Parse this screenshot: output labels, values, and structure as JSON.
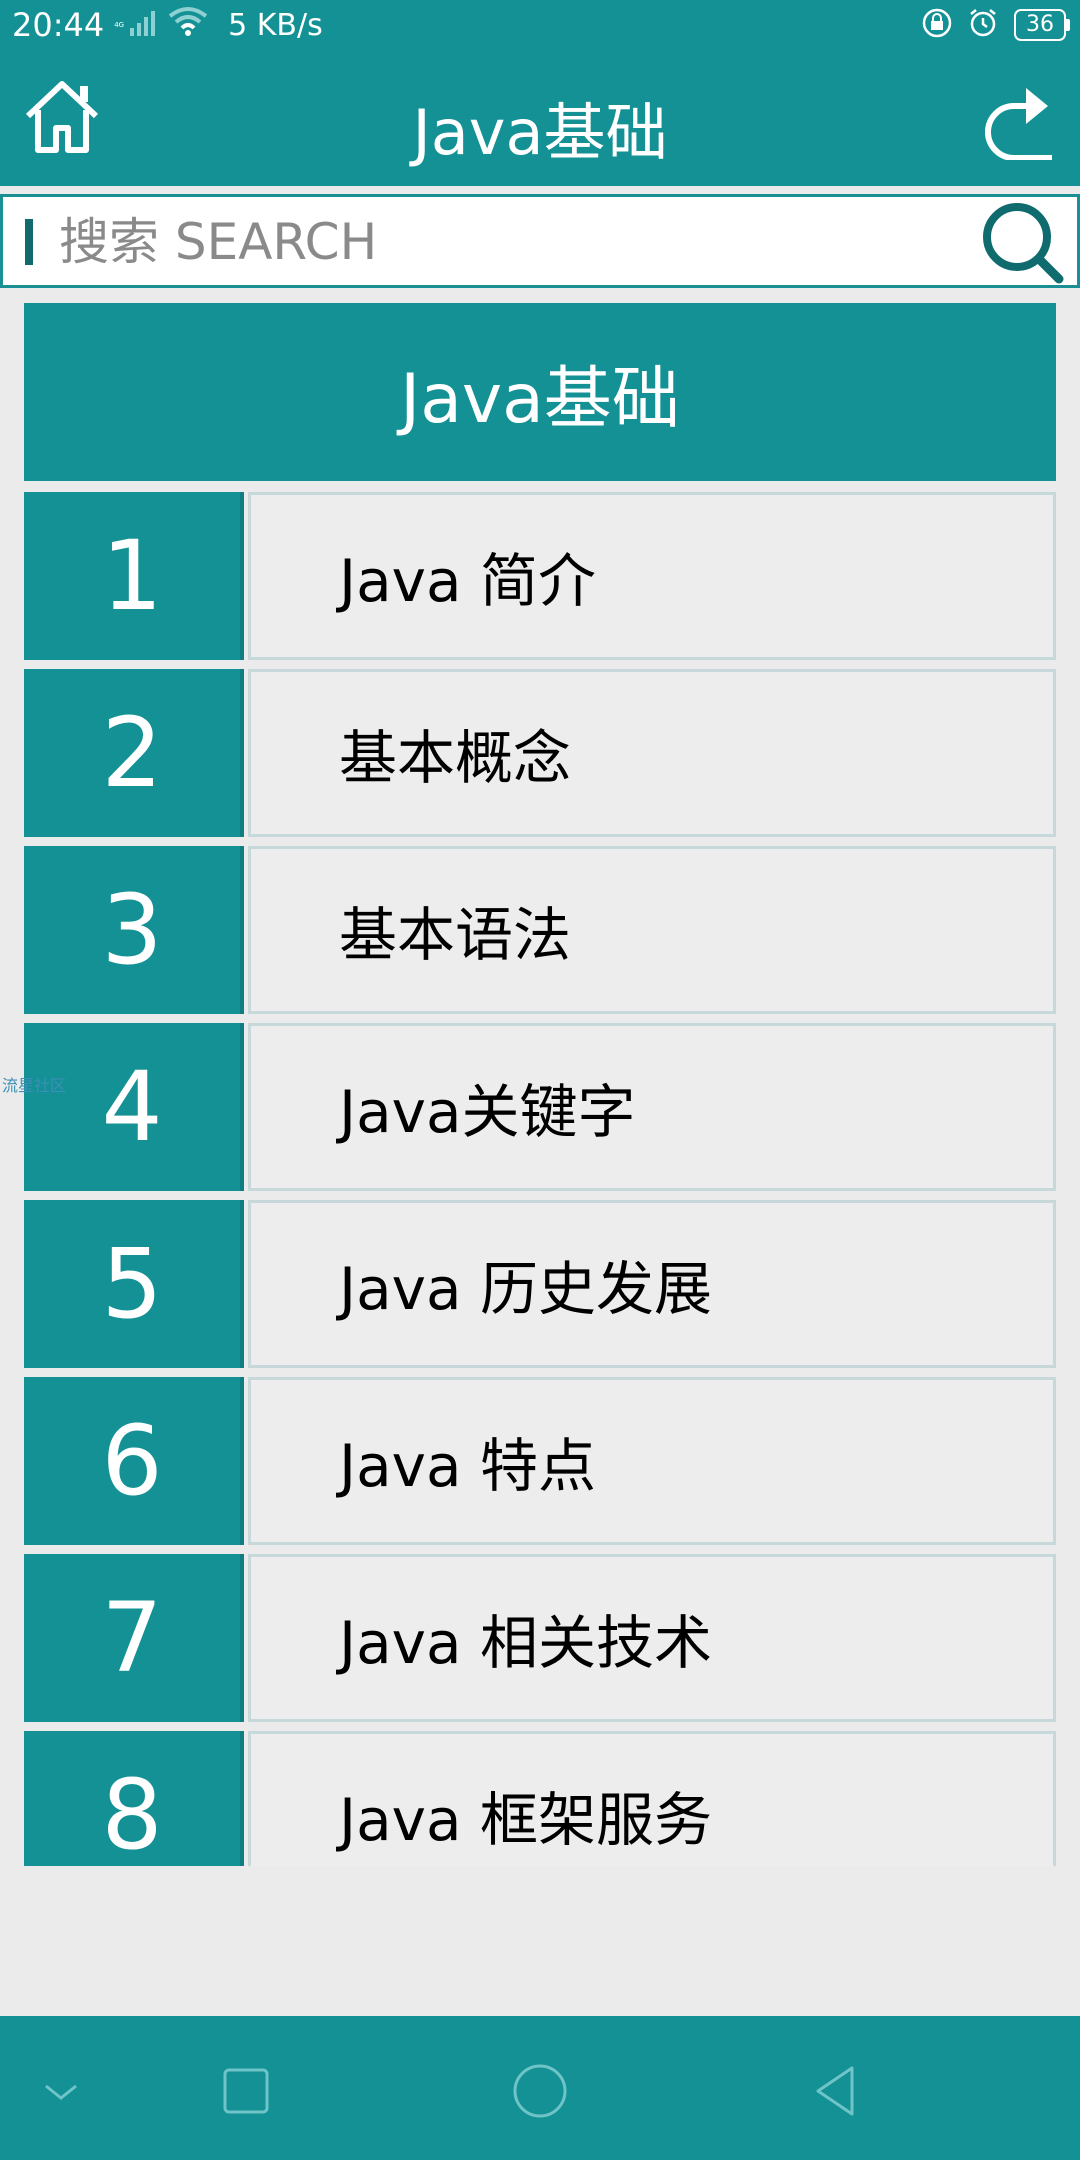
{
  "status_bar": {
    "time": "20:44",
    "network": "4G",
    "speed": "5 KB/s",
    "battery": "36",
    "icons": [
      "signal-icon",
      "wifi-icon",
      "lock-icon",
      "alarm-icon",
      "battery-icon"
    ]
  },
  "app_bar": {
    "title": "Java基础",
    "home_icon": "home-icon",
    "refresh_icon": "refresh-icon"
  },
  "search": {
    "placeholder": "搜索 SEARCH",
    "icon": "search-icon"
  },
  "section": {
    "title": "Java基础"
  },
  "list": [
    {
      "num": "1",
      "label": "Java 简介"
    },
    {
      "num": "2",
      "label": "基本概念"
    },
    {
      "num": "3",
      "label": "基本语法"
    },
    {
      "num": "4",
      "label": "Java关键字"
    },
    {
      "num": "5",
      "label": "Java 历史发展"
    },
    {
      "num": "6",
      "label": "Java 特点"
    },
    {
      "num": "7",
      "label": "Java 相关技术"
    },
    {
      "num": "8",
      "label": "Java 框架服务"
    }
  ],
  "watermark": "流星社区",
  "nav_bar": {
    "icons": [
      "chevron-down-icon",
      "recents-icon",
      "home-circle-icon",
      "back-icon"
    ]
  },
  "colors": {
    "primary": "#139195",
    "background": "#ebebeb",
    "row_background": "#ededed"
  }
}
